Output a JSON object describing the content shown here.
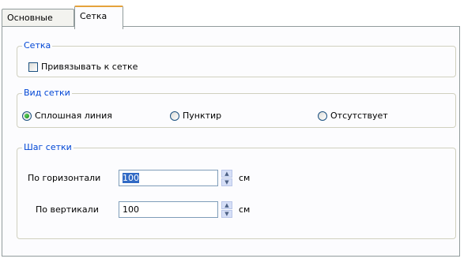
{
  "tabs": {
    "inactive_label": "Основные",
    "active_label": "Сетка"
  },
  "grid_group": {
    "title": "Сетка",
    "snap_checkbox_label": "Привязывать к сетке",
    "snap_checked": false
  },
  "grid_type_group": {
    "title": "Вид сетки",
    "options": [
      {
        "label": "Сплошная линия",
        "selected": true
      },
      {
        "label": "Пунктир",
        "selected": false
      },
      {
        "label": "Отсутствует",
        "selected": false
      }
    ]
  },
  "grid_step_group": {
    "title": "Шаг сетки",
    "horizontal": {
      "label": "По горизонтали",
      "value": "100",
      "unit": "см"
    },
    "vertical": {
      "label": "По вертикали",
      "value": "100",
      "unit": "см"
    }
  },
  "icons": {
    "spin_up": "▲",
    "spin_down": "▼"
  }
}
